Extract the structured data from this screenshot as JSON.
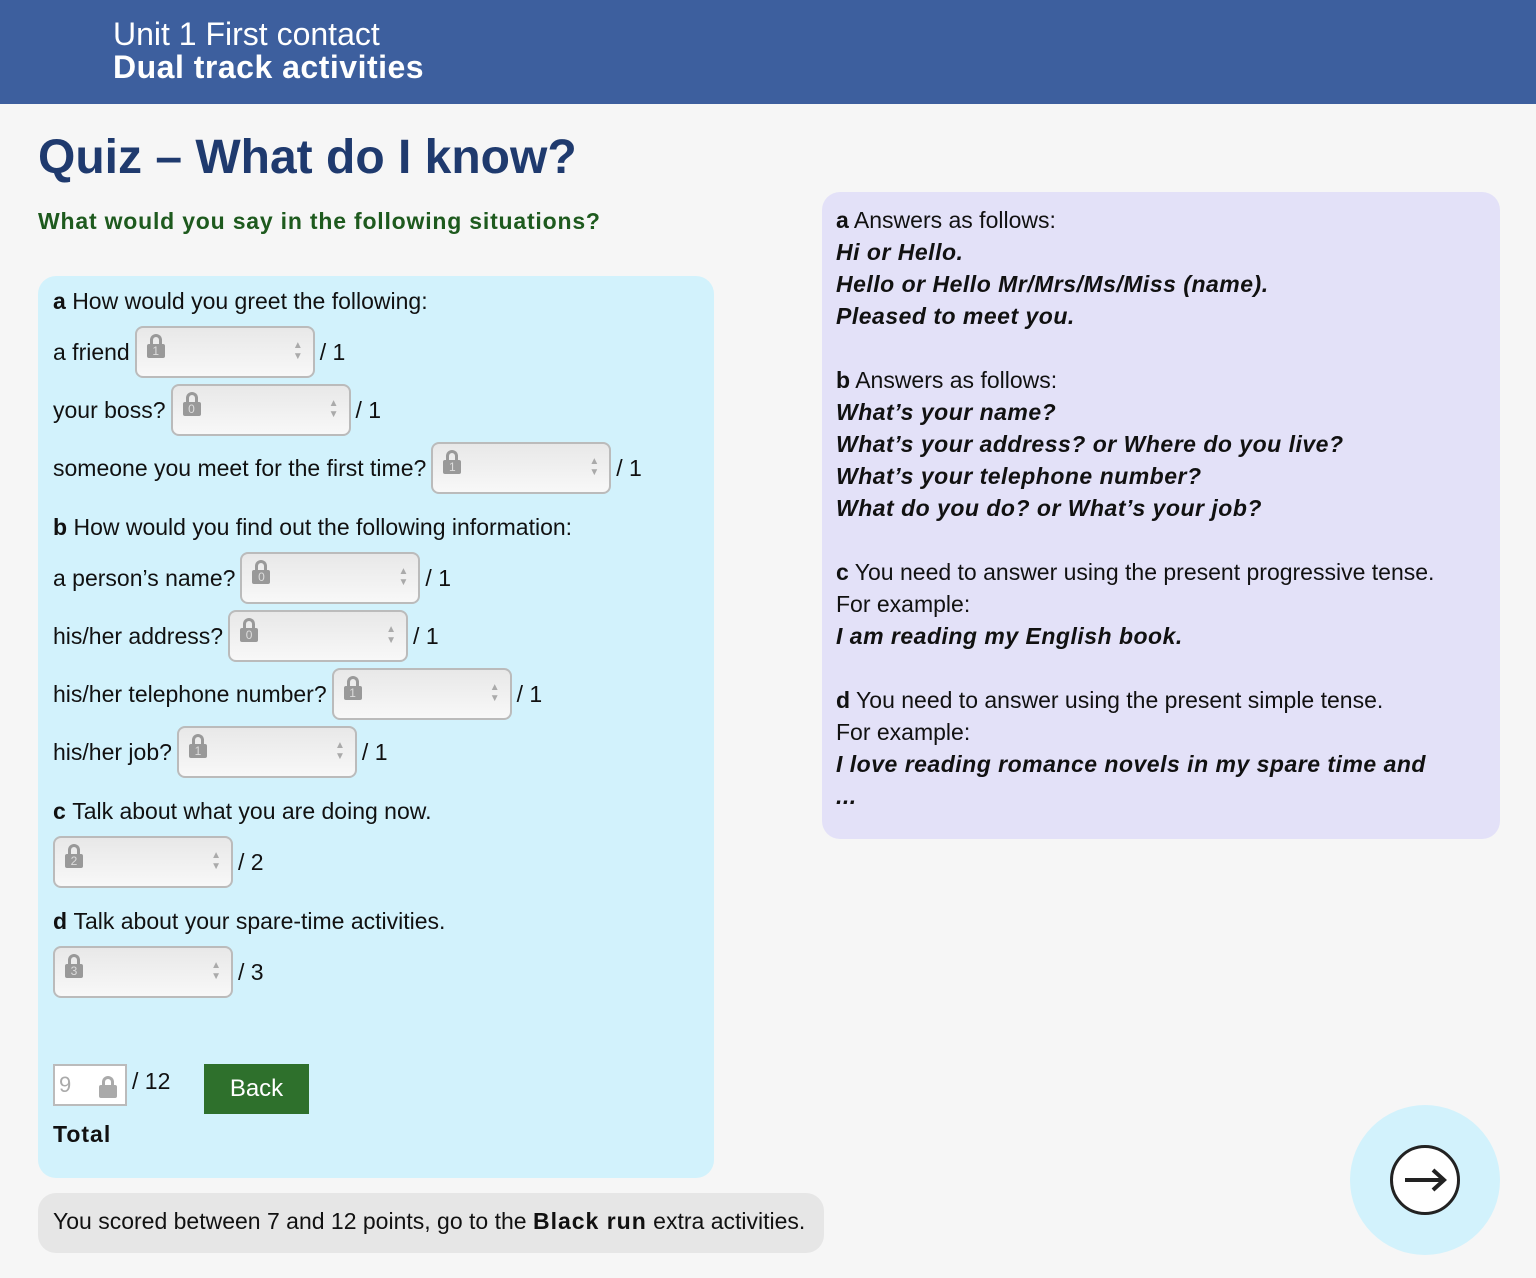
{
  "header": {
    "unit": "Unit 1 First contact",
    "track": "Dual track activities"
  },
  "title": "Quiz – What do I know?",
  "subtitle": "What would you say in the following situations?",
  "quiz": {
    "a_label": "a",
    "a_q": "How would you greet the following:",
    "b_label": "b",
    "b_q": "How would you find out the following information:",
    "c_label": "c",
    "c_q": "Talk about what you are doing now.",
    "d_label": "d",
    "d_q": "Talk about your spare-time activities.",
    "items": [
      {
        "label": "a friend",
        "value": "1",
        "max": "/ 1"
      },
      {
        "label": "your boss?",
        "value": "0",
        "max": "/ 1"
      },
      {
        "label": "someone you meet for the first time?",
        "value": "1",
        "max": "/ 1"
      },
      {
        "label": "a person’s name?",
        "value": "0",
        "max": "/ 1"
      },
      {
        "label": "his/her address?",
        "value": "0",
        "max": "/ 1"
      },
      {
        "label": "his/her telephone number?",
        "value": "1",
        "max": "/ 1"
      },
      {
        "label": "his/her job?",
        "value": "1",
        "max": "/ 1"
      },
      {
        "label": "",
        "value": "2",
        "max": "/ 2"
      },
      {
        "label": "",
        "value": "3",
        "max": "/ 3"
      }
    ],
    "total_value": "9",
    "total_max": "/ 12",
    "total_label": "Total",
    "back": "Back"
  },
  "answers": {
    "a": {
      "label": "a",
      "intro": "Answers as follows:",
      "lines": [
        "Hi or Hello.",
        "Hello or Hello Mr/Mrs/Ms/Miss (name).",
        "Pleased to meet you."
      ]
    },
    "b": {
      "label": "b",
      "intro": "Answers as follows:",
      "lines": [
        "What’s your name?",
        "What’s your address? or Where do you live?",
        "What’s your telephone number?",
        "What do you do? or What’s your job?"
      ]
    },
    "c": {
      "label": "c",
      "intro": "You need to answer using the present progressive tense.",
      "ex": "For example:",
      "lines": [
        "I am reading my English book."
      ]
    },
    "d": {
      "label": "d",
      "intro": "You need to answer using the present simple tense.",
      "ex": "For example:",
      "lines": [
        "I love reading romance novels in my spare time and",
        "..."
      ]
    }
  },
  "footer": {
    "pre": "You scored between 7 and 12 points, go to the ",
    "bold": "Black run",
    "post": " extra activities."
  },
  "colors": {
    "header": "#3d5f9e",
    "title": "#1f3a6e",
    "subtitle": "#1e5a1e",
    "left_panel": "#d2f2fc",
    "right_panel": "#e3e1f8",
    "button": "#2e702c"
  }
}
